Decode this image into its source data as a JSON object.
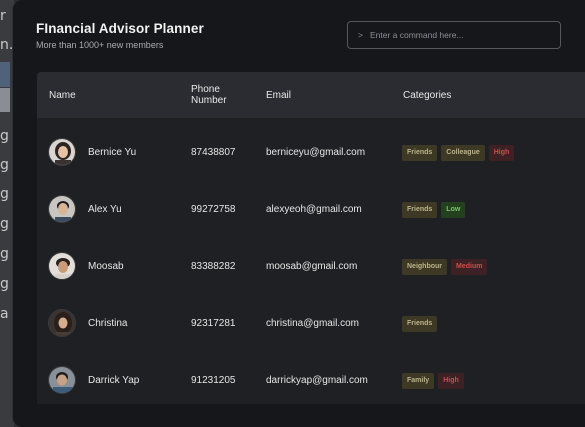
{
  "background": {
    "letters": [
      "r",
      "n.",
      "g",
      "g",
      "g",
      "g",
      "g",
      "g",
      "a"
    ]
  },
  "app": {
    "title": "FInancial Advisor Planner",
    "subtitle": "More than 1000+ new members"
  },
  "command": {
    "prompt": ">",
    "placeholder": "Enter a command here..."
  },
  "table": {
    "headers": {
      "name": "Name",
      "phone": "Phone Number",
      "email": "Email",
      "categories": "Categories"
    },
    "rows": [
      {
        "name": "Bernice Yu",
        "phone": "87438807",
        "email": "berniceyu@gmail.com",
        "tags": [
          {
            "label": "Friends",
            "kind": "friends"
          },
          {
            "label": "Colleague",
            "kind": "colleague"
          },
          {
            "label": "High",
            "kind": "high"
          }
        ]
      },
      {
        "name": "Alex Yu",
        "phone": "99272758",
        "email": "alexyeoh@gmail.com",
        "tags": [
          {
            "label": "Friends",
            "kind": "friends"
          },
          {
            "label": "Low",
            "kind": "low"
          }
        ]
      },
      {
        "name": "Moosab",
        "phone": "83388282",
        "email": "moosab@gmail.com",
        "tags": [
          {
            "label": "Neighbour",
            "kind": "neighbour"
          },
          {
            "label": "Medium",
            "kind": "medium"
          }
        ]
      },
      {
        "name": "Christina",
        "phone": "92317281",
        "email": "christina@gmail.com",
        "tags": [
          {
            "label": "Friends",
            "kind": "friends"
          }
        ]
      },
      {
        "name": "Darrick Yap",
        "phone": "91231205",
        "email": "darrickyap@gmail.com",
        "tags": [
          {
            "label": "Family",
            "kind": "family"
          },
          {
            "label": "High",
            "kind": "high"
          }
        ]
      }
    ]
  },
  "colors": {
    "window_bg": "#16171a",
    "header_bg": "#2a2c31",
    "body_bg": "#1f2024",
    "tag_neutral_bg": "#3d3924",
    "tag_high_bg": "#3e2124",
    "tag_low_bg": "#23401f"
  }
}
